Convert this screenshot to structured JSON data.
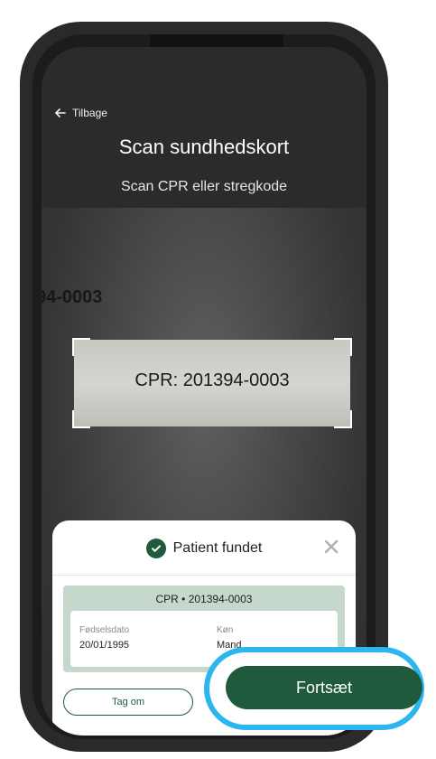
{
  "header": {
    "back_label": "Tilbage",
    "title": "Scan sundhedskort",
    "subtitle": "Scan CPR eller stregkode"
  },
  "camera": {
    "partial_text": "94-0003",
    "scan_text": "CPR: 201394-0003"
  },
  "result": {
    "status": "Patient fundet",
    "cpr_line": "CPR • 201394-0003",
    "birthdate_label": "Fødselsdato",
    "birthdate_value": "20/01/1995",
    "gender_label": "Køn",
    "gender_value": "Mand"
  },
  "actions": {
    "retake_label": "Tag om",
    "continue_label": "Fortsæt"
  },
  "colors": {
    "brand_green": "#1f5a3c",
    "highlight_blue": "#2cb6f0",
    "card_green": "#c6d7cc"
  }
}
